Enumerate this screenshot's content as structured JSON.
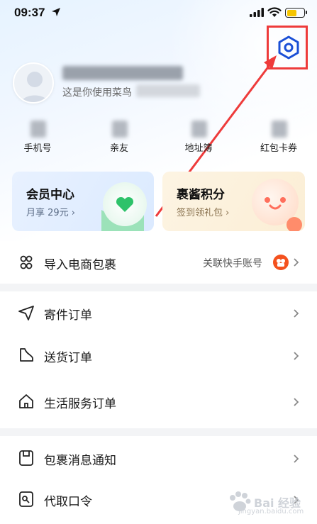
{
  "status_bar": {
    "time": "09:37",
    "battery_level": 0.6,
    "battery_color": "#f6c500"
  },
  "profile": {
    "subtitle": "这是你使用菜鸟",
    "name_blurred": true
  },
  "quick_actions": [
    {
      "label": "手机号",
      "icon": "blurred-icon"
    },
    {
      "label": "亲友",
      "icon": "blurred-icon"
    },
    {
      "label": "地址簿",
      "icon": "blurred-icon"
    },
    {
      "label": "红包卡券",
      "icon": "blurred-icon"
    }
  ],
  "cards": {
    "vip": {
      "title": "会员中心",
      "subtitle": "月享 29元 ›",
      "icon": "heart-icon"
    },
    "points": {
      "title": "裹酱积分",
      "subtitle": "签到领礼包 ›",
      "icon": "smile-mascot-icon"
    }
  },
  "list": {
    "import": {
      "label": "导入电商包裹",
      "right_text": "关联快手账号",
      "icon": "people-icon",
      "badge_icon": "kuaishou-icon"
    },
    "section_orders": [
      {
        "label": "寄件订单",
        "icon": "paper-plane-icon"
      },
      {
        "label": "送货订单",
        "icon": "boot-icon"
      },
      {
        "label": "生活服务订单",
        "icon": "home-icon"
      }
    ],
    "section_misc": [
      {
        "label": "包裹消息通知",
        "icon": "message-box-icon"
      },
      {
        "label": "代取口令",
        "icon": "key-box-icon"
      }
    ]
  },
  "annotation": {
    "highlight_color": "#ee3b3b"
  },
  "watermark": {
    "text": "Bai 经验",
    "url": "jingyan.baidu.com"
  },
  "colors": {
    "accent": "#1a4fd6",
    "highlight": "#ee3b3b"
  }
}
